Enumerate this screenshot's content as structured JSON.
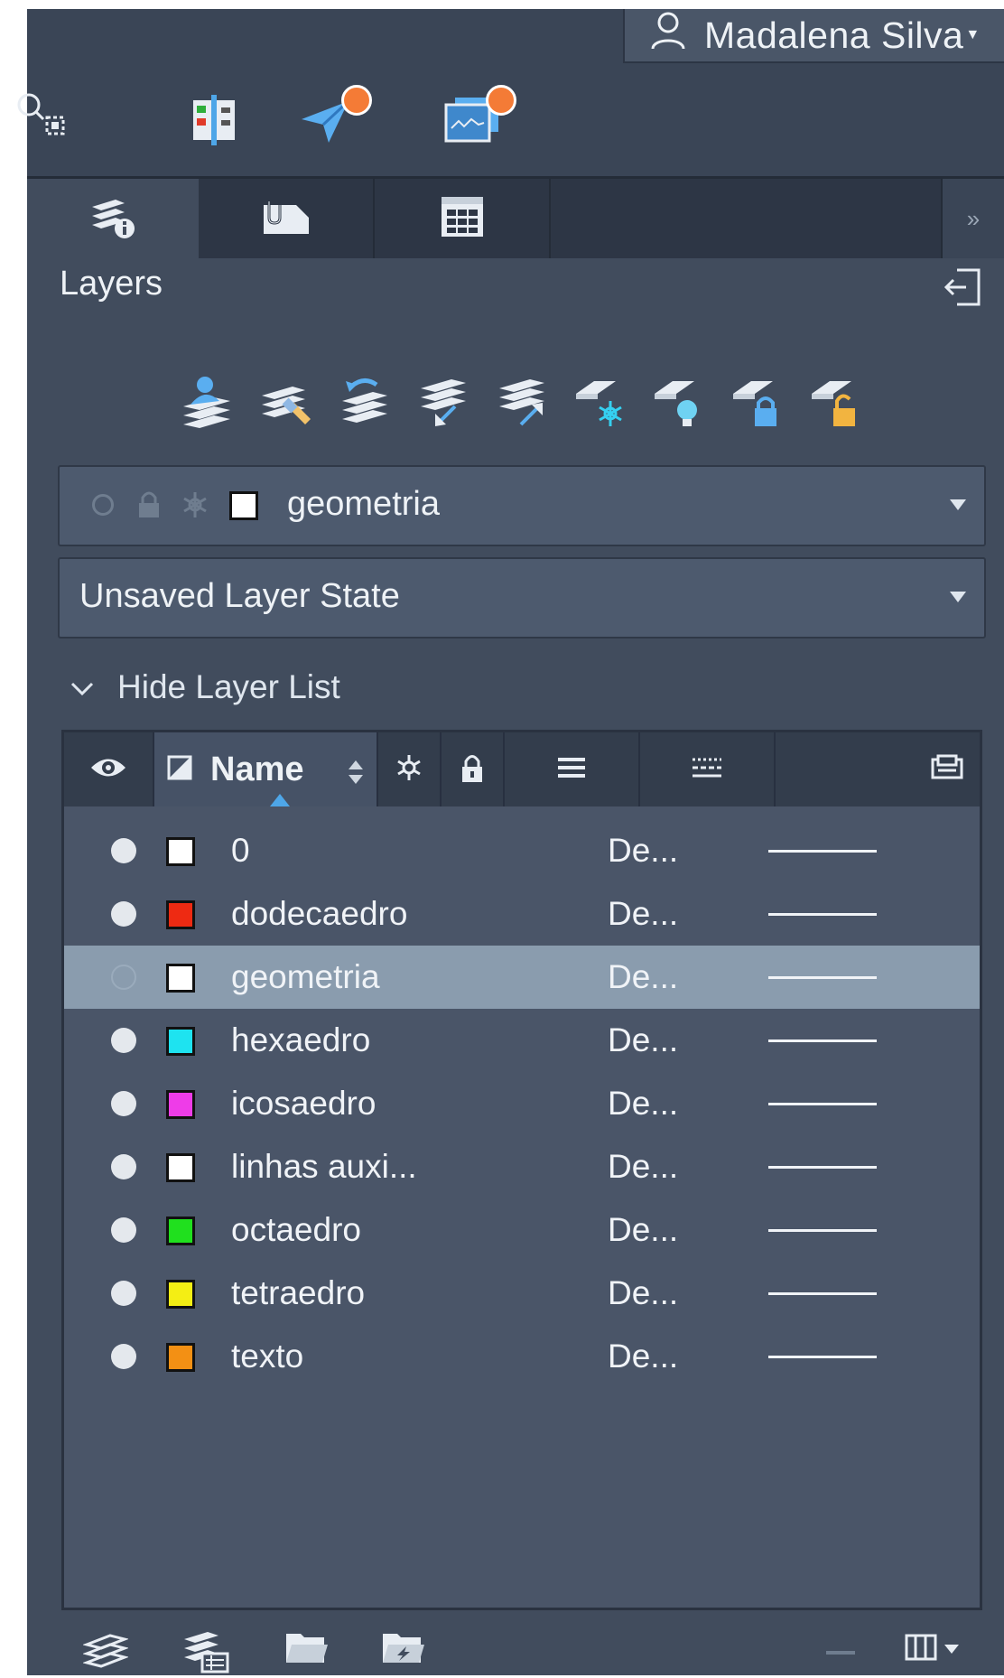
{
  "user": {
    "name": "Madalena Silva",
    "icon": "user-icon"
  },
  "toolbar": {
    "icons": [
      "zoom-selection-icon",
      "compare-icon",
      "share-icon",
      "monitor-icon"
    ],
    "badge_color": "#f47b36"
  },
  "tabs": [
    {
      "id": "layers",
      "icon": "layers-info-icon",
      "active": true
    },
    {
      "id": "attach",
      "icon": "attach-icon",
      "active": false
    },
    {
      "id": "table",
      "icon": "table-icon",
      "active": false
    }
  ],
  "tabs_more_label": "»",
  "panel": {
    "title": "Layers"
  },
  "layer_tools": [
    "new-layer-icon",
    "delete-layer-icon",
    "set-current-layer-icon",
    "merge-layers-icon",
    "isolate-layer-icon",
    "freeze-layer-icon",
    "turn-off-layer-icon",
    "lock-layer-icon",
    "unlock-layer-icon"
  ],
  "current_layer": {
    "name": "geometria",
    "color": "#ffffff"
  },
  "layer_state": {
    "label": "Unsaved Layer State"
  },
  "hide_list_label": "Hide Layer List",
  "columns": {
    "name": "Name"
  },
  "layers": [
    {
      "name": "0",
      "color": "#ffffff",
      "on": true,
      "linetype": "De...",
      "selected": false
    },
    {
      "name": "dodecaedro",
      "color": "#ee2a12",
      "on": true,
      "linetype": "De...",
      "selected": false
    },
    {
      "name": "geometria",
      "color": "#ffffff",
      "on": false,
      "linetype": "De...",
      "selected": true
    },
    {
      "name": "hexaedro",
      "color": "#1ee3f0",
      "on": true,
      "linetype": "De...",
      "selected": false
    },
    {
      "name": "icosaedro",
      "color": "#ee3ce8",
      "on": true,
      "linetype": "De...",
      "selected": false
    },
    {
      "name": "linhas auxi...",
      "color": "#ffffff",
      "on": true,
      "linetype": "De...",
      "selected": false
    },
    {
      "name": "octaedro",
      "color": "#20e01e",
      "on": true,
      "linetype": "De...",
      "selected": false
    },
    {
      "name": "tetraedro",
      "color": "#f4ee14",
      "on": true,
      "linetype": "De...",
      "selected": false
    },
    {
      "name": "texto",
      "color": "#f39014",
      "on": true,
      "linetype": "De...",
      "selected": false
    }
  ],
  "colors": {
    "accent": "#4ea6e8",
    "panel_bg": "#414c5d",
    "selected_row": "#8a9cae"
  }
}
